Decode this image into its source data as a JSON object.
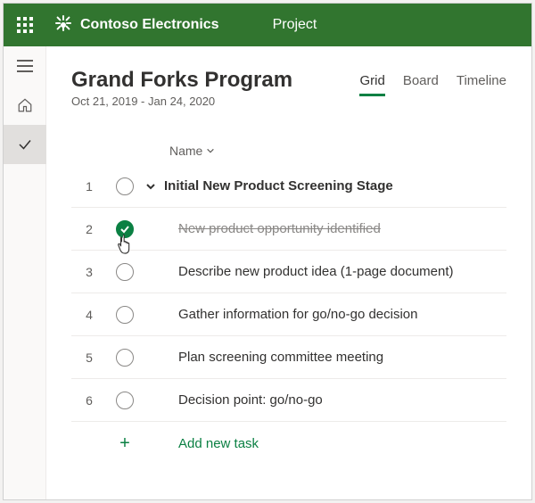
{
  "topbar": {
    "brand": "Contoso Electronics",
    "app": "Project"
  },
  "project": {
    "title": "Grand Forks Program",
    "date_range": "Oct 21, 2019 - Jan 24, 2020"
  },
  "tabs": {
    "grid": "Grid",
    "board": "Board",
    "timeline": "Timeline"
  },
  "columns": {
    "name": "Name"
  },
  "rows": [
    {
      "num": "1",
      "text": "Initial New Product Screening Stage"
    },
    {
      "num": "2",
      "text": "New product opportunity identified"
    },
    {
      "num": "3",
      "text": "Describe new product idea (1-page document)"
    },
    {
      "num": "4",
      "text": "Gather information for go/no-go decision"
    },
    {
      "num": "5",
      "text": "Plan screening committee meeting"
    },
    {
      "num": "6",
      "text": "Decision point: go/no-go"
    }
  ],
  "add_task": "Add new task"
}
